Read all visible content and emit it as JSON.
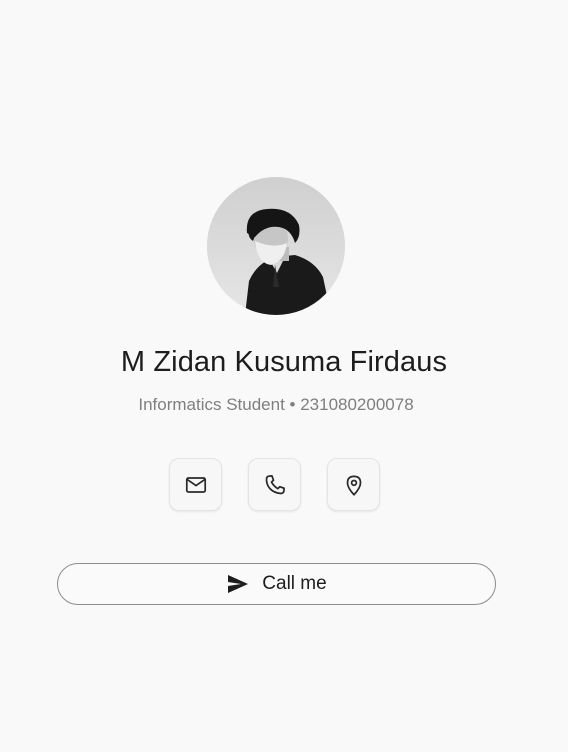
{
  "profile": {
    "name": "M Zidan Kusuma Firdaus",
    "subtitle": "Informatics Student • 231080200078",
    "avatar_icon": "profile-photo"
  },
  "actions": {
    "icons": [
      "mail-icon",
      "phone-icon",
      "location-pin-icon"
    ],
    "call_label": "Call me",
    "call_icon": "send-icon"
  },
  "colors": {
    "background": "#f9f9f9",
    "name_text": "#1d1d1d",
    "subtitle_text": "#7f7f7f",
    "button_border": "#8c8c8c"
  }
}
